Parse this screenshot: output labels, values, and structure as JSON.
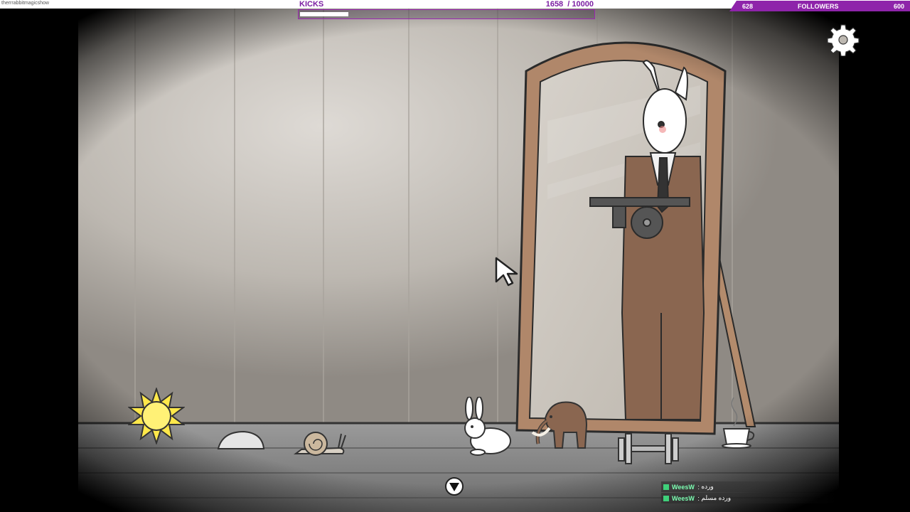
{
  "stream": {
    "url": "therrrabbitmagicshow"
  },
  "kicks": {
    "label": "KICKS",
    "count_text": "1658  / 10000",
    "current": 1658,
    "goal": 10000
  },
  "followers": {
    "left_value": "628",
    "label": "FOLLOWERS",
    "right_value": "600"
  },
  "settings": {
    "icon": "gear-icon"
  },
  "inventory": {
    "items": [
      "sun",
      "stone",
      "snail",
      "white-rabbit",
      "mammoth",
      "dumbbell",
      "teacup"
    ]
  },
  "navigation": {
    "down_icon": "down-arrow-icon"
  },
  "chat": {
    "messages": [
      {
        "user": "WeesW",
        "separator": " : ",
        "text": "ورده"
      },
      {
        "user": "WeesW",
        "separator": " : ",
        "text": "ورده مسلم"
      }
    ]
  },
  "colors": {
    "accent": "#8e24aa",
    "wall": "#cfcac4",
    "floor": "#8a8a8a",
    "mirror_frame": "#b0876a",
    "suit": "#8a6650"
  }
}
